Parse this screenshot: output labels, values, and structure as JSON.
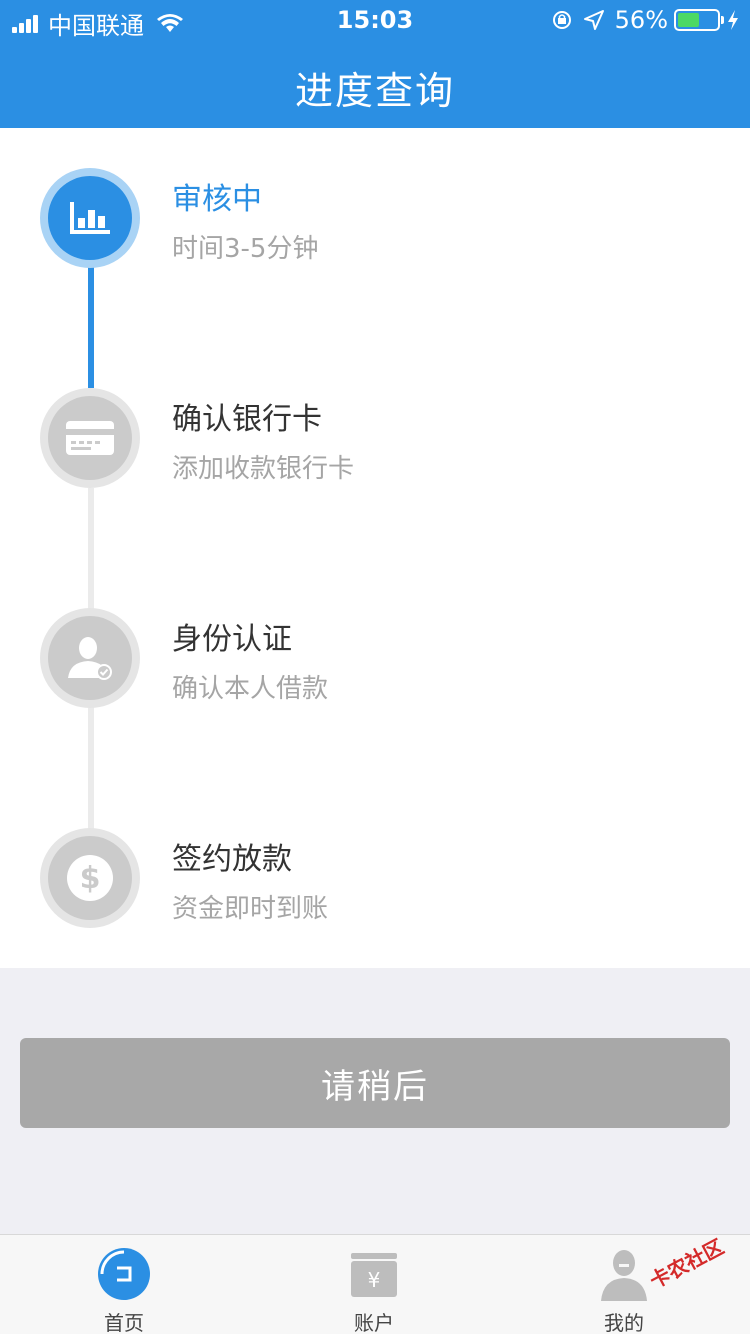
{
  "status_bar": {
    "carrier": "中国联通",
    "time": "15:03",
    "battery_percent": "56%",
    "battery_level": 0.56
  },
  "header": {
    "title": "进度查询"
  },
  "steps": [
    {
      "title": "审核中",
      "subtitle": "时间3-5分钟",
      "icon": "bar-chart-icon",
      "state": "active"
    },
    {
      "title": "确认银行卡",
      "subtitle": "添加收款银行卡",
      "icon": "bank-card-icon",
      "state": "pending"
    },
    {
      "title": "身份认证",
      "subtitle": "确认本人借款",
      "icon": "user-verify-icon",
      "state": "pending"
    },
    {
      "title": "签约放款",
      "subtitle": "资金即时到账",
      "icon": "dollar-icon",
      "state": "pending"
    }
  ],
  "action_button": {
    "label": "请稍后"
  },
  "tabbar": {
    "items": [
      {
        "label": "首页",
        "icon": "home-icon",
        "selected": true
      },
      {
        "label": "账户",
        "icon": "wallet-icon",
        "selected": false
      },
      {
        "label": "我的",
        "icon": "profile-icon",
        "selected": false
      }
    ]
  },
  "watermark": {
    "text": "卡农社区"
  },
  "colors": {
    "primary": "#2b8fe3",
    "inactive_circle": "#cbcbcb",
    "button_disabled": "#a8a8a8",
    "battery_green": "#4cd964"
  }
}
